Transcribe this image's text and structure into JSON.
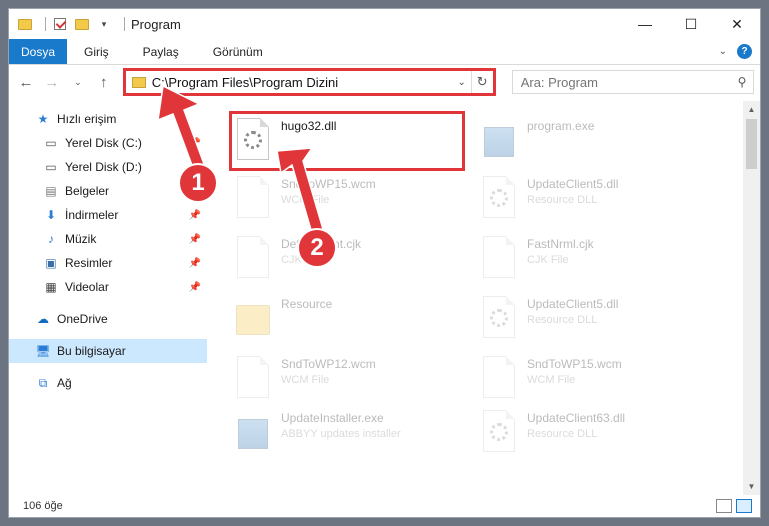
{
  "window": {
    "title": "Program"
  },
  "ribbon": {
    "tabs": [
      "Dosya",
      "Giriş",
      "Paylaş",
      "Görünüm"
    ]
  },
  "address": {
    "path": "C:\\Program Files\\Program Dizini"
  },
  "search": {
    "placeholder": "Ara: Program"
  },
  "sidebar": {
    "quick_access": "Hızlı erişim",
    "items": [
      "Yerel Disk (C:)",
      "Yerel Disk (D:)",
      "Belgeler",
      "İndirmeler",
      "Müzik",
      "Resimler",
      "Videolar"
    ],
    "onedrive": "OneDrive",
    "this_pc": "Bu bilgisayar",
    "network": "Ağ"
  },
  "files": [
    {
      "name": "hugo32.dll",
      "type": ""
    },
    {
      "name": "program.exe",
      "type": ""
    },
    {
      "name": "SndToWP15.wcm",
      "type": "WCM File"
    },
    {
      "name": "UpdateClient5.dll",
      "type": "Resource DLL"
    },
    {
      "name": "DefaultFont.cjk",
      "type": "CJK File"
    },
    {
      "name": "FastNrml.cjk",
      "type": "CJK File"
    },
    {
      "name": "Resource",
      "type": ""
    },
    {
      "name": "UpdateClient5.dll",
      "type": "Resource DLL"
    },
    {
      "name": "SndToWP12.wcm",
      "type": "WCM File"
    },
    {
      "name": "SndToWP15.wcm",
      "type": "WCM File"
    },
    {
      "name": "UpdateInstaller.exe",
      "type": "ABBYY updates installer"
    },
    {
      "name": "UpdateClient63.dll",
      "type": "Resource DLL"
    }
  ],
  "status": {
    "count": "106 öğe"
  },
  "annotations": {
    "step1": "1",
    "step2": "2",
    "accent": "#e0363a"
  }
}
